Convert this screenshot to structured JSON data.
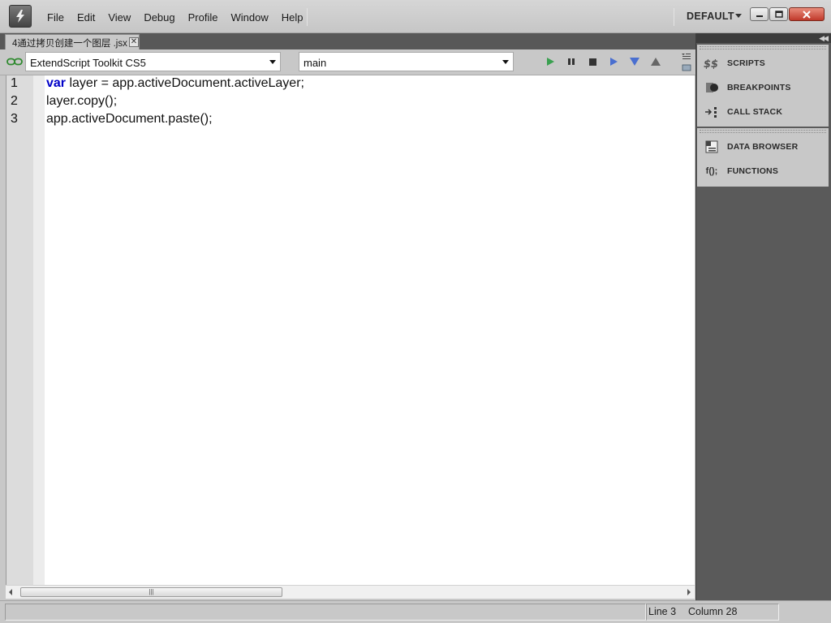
{
  "window": {
    "menu": [
      "File",
      "Edit",
      "View",
      "Debug",
      "Profile",
      "Window",
      "Help"
    ],
    "workspace": "DEFAULT"
  },
  "tab": {
    "title": "4通过拷贝创建一个图层 .jsx",
    "close": "✕"
  },
  "toolbar": {
    "target": "ExtendScript Toolkit CS5",
    "function": "main"
  },
  "editor": {
    "lines": [
      {
        "number": "1",
        "keyword": "var",
        "text": " layer = app.activeDocument.activeLayer;"
      },
      {
        "number": "2",
        "keyword": "",
        "text": "layer.copy();"
      },
      {
        "number": "3",
        "keyword": "",
        "text": "app.activeDocument.paste();"
      }
    ]
  },
  "scrollbar": {
    "grip": "|||"
  },
  "status": {
    "line": "Line 3",
    "column": "Column 28"
  },
  "panels": {
    "scripts": "SCRIPTS",
    "breakpoints": "BREAKPOINTS",
    "call_stack": "CALL STACK",
    "data_browser": "DATA BROWSER",
    "functions": "FUNCTIONS",
    "functions_icon_text": "f();"
  },
  "colors": {
    "keyword": "#0000c8",
    "run_button": "#3aa050",
    "step_buttons": "#4a6fd0"
  }
}
